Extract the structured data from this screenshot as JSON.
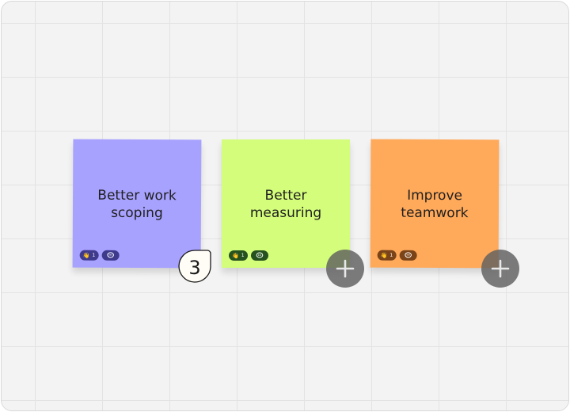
{
  "notes": [
    {
      "text": "Better work\nscoping",
      "color": "#a8a2ff",
      "reaction_emoji": "👋",
      "reaction_count": "1"
    },
    {
      "text": "Better\nmeasuring",
      "color": "#d3fd7a",
      "reaction_emoji": "👋",
      "reaction_count": "1"
    },
    {
      "text": "Improve\nteamwork",
      "color": "#ffa95a",
      "reaction_emoji": "👋",
      "reaction_count": "1"
    }
  ],
  "cursor_badge": {
    "count": "3"
  },
  "icons": {
    "add": "plus-icon",
    "comment": "comment-icon"
  },
  "colors": {
    "canvas": "#f3f3f3",
    "grid": "#e3e3e3",
    "add_button": "#5f5f5f"
  }
}
